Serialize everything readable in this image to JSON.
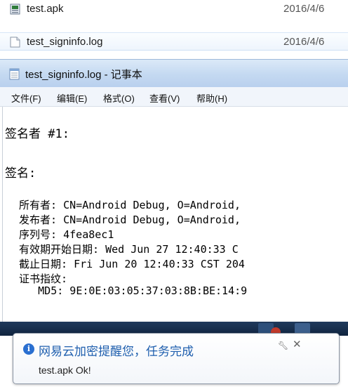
{
  "explorer": {
    "files": [
      {
        "name": "test.apk",
        "date": "2016/4/6",
        "icon": "apk-file-icon"
      },
      {
        "name": "test_signinfo.log",
        "date": "2016/4/6",
        "icon": "log-file-icon"
      }
    ]
  },
  "notepad": {
    "title": "test_signinfo.log - 记事本",
    "menu": [
      "文件(F)",
      "编辑(E)",
      "格式(O)",
      "查看(V)",
      "帮助(H)"
    ],
    "lines": [
      "签名者 #1:",
      "签名:",
      "  所有者: CN=Android Debug, O=Android,",
      "  发布者: CN=Android Debug, O=Android,",
      "  序列号: 4fea8ec1",
      "  有效期开始日期: Wed Jun 27 12:40:33 C",
      "  截止日期: Fri Jun 20 12:40:33 CST 204",
      "  证书指纹:",
      "     MD5: 9E:0E:03:05:37:03:8B:BE:14:9"
    ]
  },
  "notification": {
    "title": "网易云加密提醒您，任务完成",
    "message": "test.apk Ok!",
    "icons": [
      "info-icon",
      "settings-icon",
      "close-icon"
    ],
    "accent_color": "#1f5fae"
  }
}
